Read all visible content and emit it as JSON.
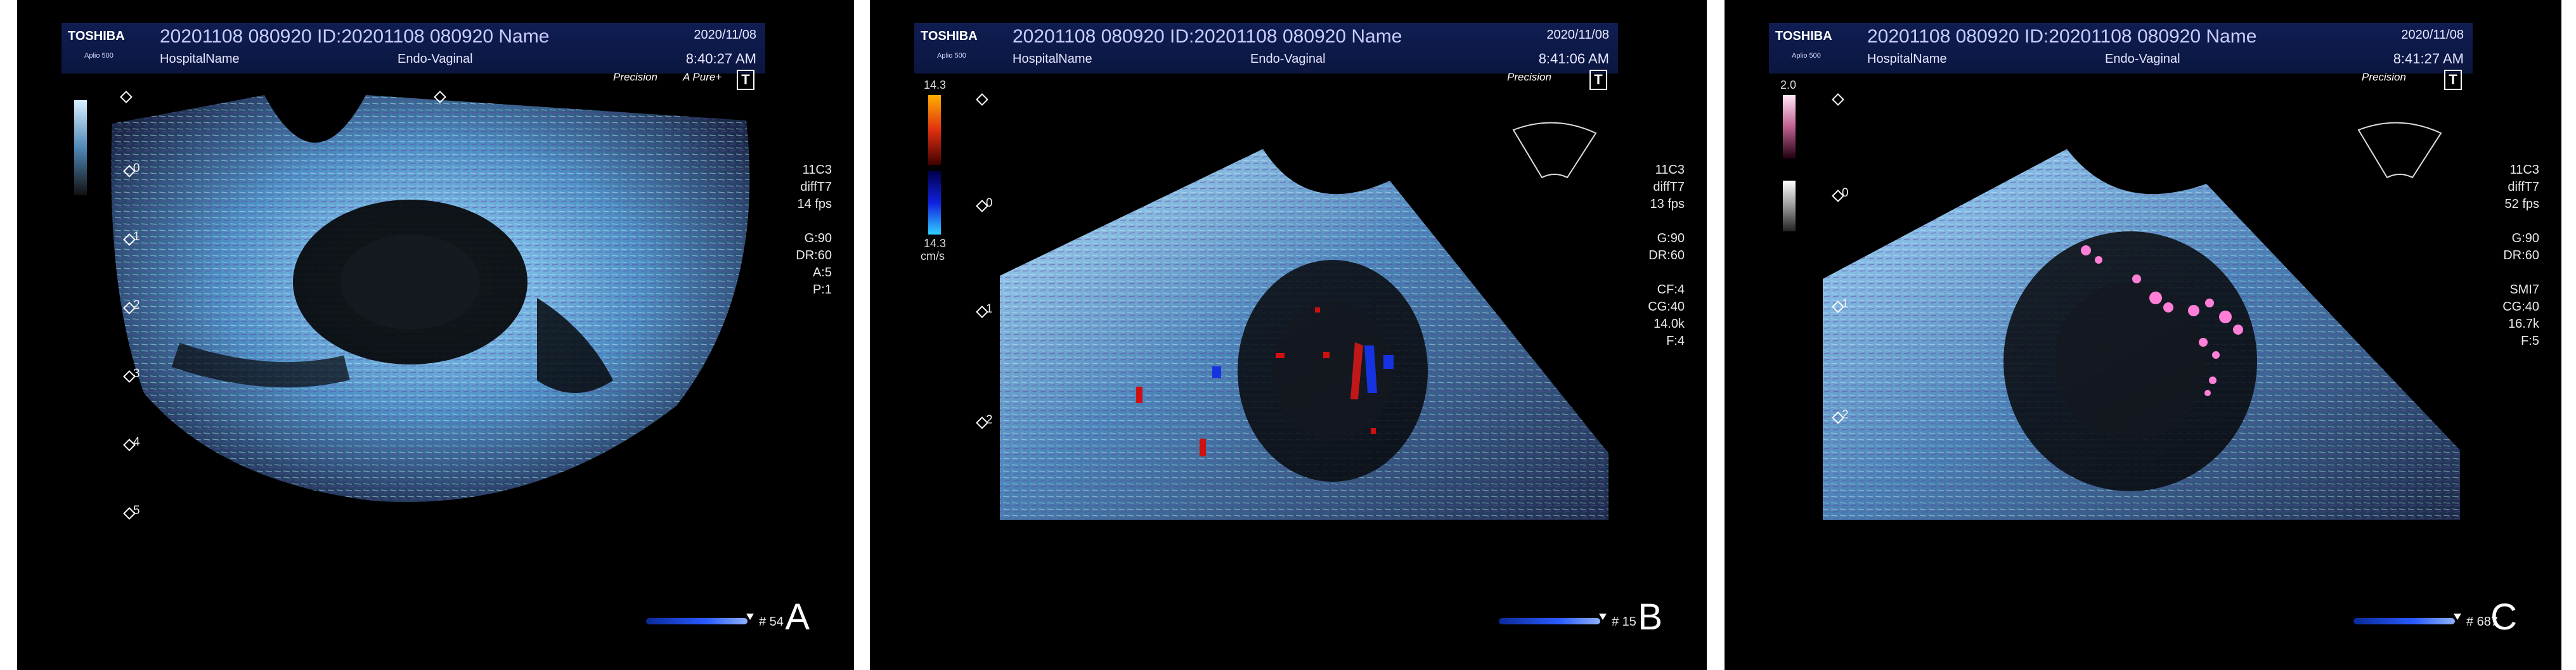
{
  "common": {
    "brand": "TOSHIBA",
    "model": "Aplio 500",
    "patient": "20201108 080920 ID:20201108 080920 Name",
    "hospital": "HospitalName",
    "exam": "Endo-Vaginal",
    "date": "2020/11/08",
    "precision": "Precision",
    "tlabel": "T"
  },
  "panels": {
    "a": {
      "time": "8:40:27 AM",
      "apure": "A Pure+",
      "params": [
        "11C3",
        "diffT7",
        "14 fps",
        "",
        "G:90",
        "DR:60",
        "A:5",
        "P:1"
      ],
      "depth": [
        "0",
        "1",
        "2",
        "3",
        "4",
        "5"
      ],
      "frame": "# 54",
      "letter": "A"
    },
    "b": {
      "time": "8:41:06 AM",
      "params": [
        "11C3",
        "diffT7",
        "13 fps",
        "",
        "G:90",
        "DR:60",
        "",
        "CF:4",
        "CG:40",
        "14.0k",
        "F:4"
      ],
      "scale_top": "14.3",
      "scale_bottom": "14.3",
      "scale_unit": "cm/s",
      "depth": [
        "0",
        "1",
        "2"
      ],
      "frame": "# 15",
      "letter": "B"
    },
    "c": {
      "time": "8:41:27 AM",
      "params": [
        "11C3",
        "diffT7",
        "52 fps",
        "",
        "G:90",
        "DR:60",
        "",
        "SMI7",
        "CG:40",
        "16.7k",
        "F:5"
      ],
      "scale_top": "2.0",
      "depth": [
        "0",
        "1",
        "2"
      ],
      "frame": "# 687",
      "letter": "C"
    }
  },
  "colors": {
    "tissue": "#8fd3ff",
    "header": "#0f1d52",
    "doppler_red": "#d01010",
    "doppler_blue": "#1533e0",
    "smi_pink": "#ff7fd8"
  }
}
